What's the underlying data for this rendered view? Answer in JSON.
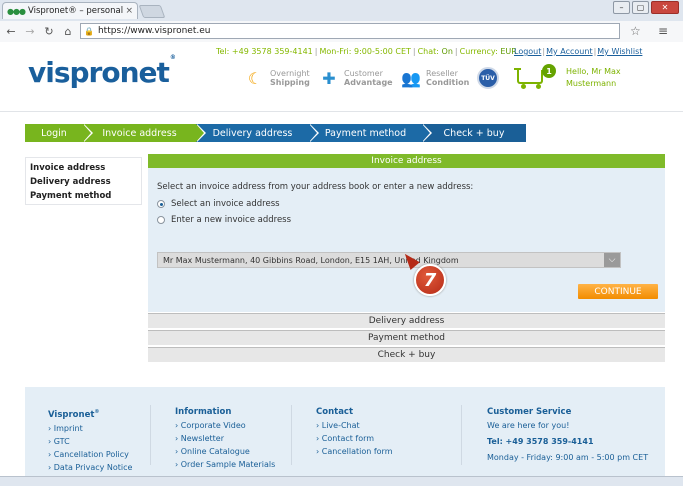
{
  "browser": {
    "tab_title": "Vispronet® – personalise",
    "tab_close": "×",
    "url": "https://www.vispronet.eu",
    "window_min": "–",
    "window_max": "▢",
    "window_close": "✕"
  },
  "header": {
    "logo": "vispronet",
    "logo_reg": "®",
    "tel": "Tel: +49 3578 359-4141",
    "hours": "Mon-Fri: 9:00-5:00 CET",
    "chat_label": "Chat:",
    "chat_status": "On",
    "currency_label": "Currency:",
    "currency_value": "EUR",
    "link_logout": "Logout",
    "link_account": "My Account",
    "link_wishlist": "My Wishlist",
    "features": [
      {
        "line1": "Overnight",
        "line2": "Shipping",
        "icon": "moon-star-icon"
      },
      {
        "line1": "Customer",
        "line2": "Advantage",
        "icon": "puzzle-icon"
      },
      {
        "line1": "Reseller",
        "line2": "Condition",
        "icon": "people-icon"
      }
    ],
    "tuv_label": "TÜV",
    "cart_count": "1",
    "greeting_line1": "Hello, Mr Max",
    "greeting_line2": "Mustermann"
  },
  "steps": [
    {
      "label": "Login"
    },
    {
      "label": "Invoice address"
    },
    {
      "label": "Delivery address"
    },
    {
      "label": "Payment method"
    },
    {
      "label": "Check + buy"
    }
  ],
  "sidebar": {
    "items": [
      "Invoice address",
      "Delivery address",
      "Payment method"
    ]
  },
  "panel": {
    "title": "Invoice address",
    "prompt": "Select an invoice address from your address book or enter a new address:",
    "option_select": "Select an invoice address",
    "option_new": "Enter a new invoice address",
    "selected_address": "Mr Max Mustermann, 40 Gibbins Road, London, E15 1AH, United Kingdom",
    "continue_label": "CONTINUE",
    "collapsed": [
      "Delivery address",
      "Payment method",
      "Check + buy"
    ]
  },
  "marker": {
    "label": "7",
    "color": "#c0391f"
  },
  "footer": {
    "col1": {
      "title": "Vispronet",
      "title_reg": "®",
      "items": [
        "Imprint",
        "GTC",
        "Cancellation Policy",
        "Data Privacy Notice"
      ]
    },
    "col2": {
      "title": "Information",
      "items": [
        "Corporate Video",
        "Newsletter",
        "Online Catalogue",
        "Order Sample Materials"
      ]
    },
    "col3": {
      "title": "Contact",
      "items": [
        "Live-Chat",
        "Contact form",
        "Cancellation form"
      ]
    },
    "col4": {
      "title": "Customer Service",
      "subtitle": "We are here for you!",
      "tel": "Tel: +49 3578 359-4141",
      "hours": "Monday - Friday: 9:00 am - 5:00 pm CET"
    }
  },
  "colors": {
    "green": "#7fba2a",
    "blue": "#1a5f97",
    "orange": "#f28c00",
    "panel_bg": "#e4eef6"
  }
}
